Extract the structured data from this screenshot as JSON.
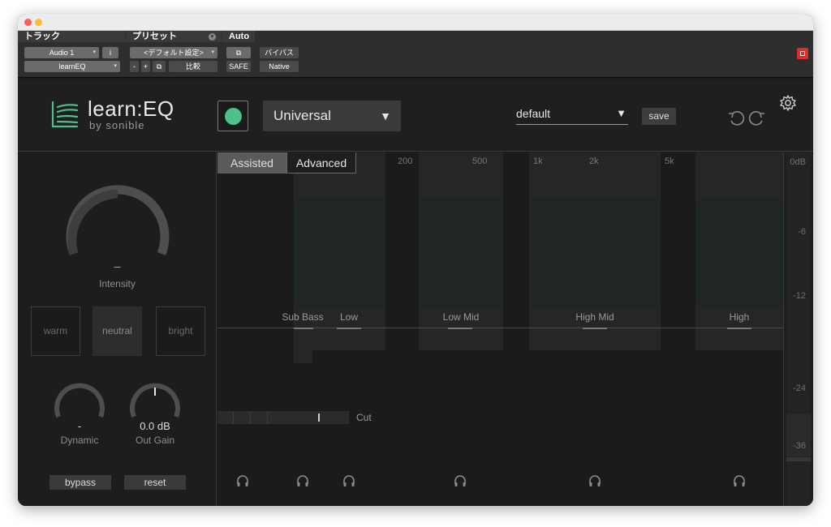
{
  "host": {
    "track_label": "トラック",
    "preset_label": "プリセット",
    "auto_label": "Auto",
    "track_name": "Audio 1",
    "track_index": "i",
    "plugin_name": "learnEQ",
    "preset_name": "<デフォルト設定>",
    "preset_minus": "-",
    "preset_plus": "+",
    "compare_label": "比較",
    "bypass_label": "バイパス",
    "safe_label": "SAFE",
    "native_label": "Native"
  },
  "plugin": {
    "logo_text": "learn:EQ",
    "logo_by": "by sonible",
    "profile_value": "Universal",
    "preset_value": "default",
    "save_label": "save",
    "intensity_value": "–",
    "intensity_label": "Intensity",
    "styles": [
      "warm",
      "neutral",
      "bright"
    ],
    "selected_style": "neutral",
    "dynamic_value": "-",
    "dynamic_label": "Dynamic",
    "outgain_value": "0.0 dB",
    "outgain_label": "Out Gain",
    "bypass_button": "bypass",
    "reset_button": "reset"
  },
  "eq": {
    "tabs": [
      "Assisted",
      "Advanced"
    ],
    "active_tab": "Advanced",
    "freq_labels": [
      "200",
      "500",
      "1k",
      "2k",
      "5k"
    ],
    "bands": [
      "Sub Bass",
      "Low",
      "Low Mid",
      "High Mid",
      "High"
    ],
    "cut_label": "Cut"
  },
  "meter": {
    "labels": [
      "0dB",
      "-6",
      "-12",
      "-24",
      "-36"
    ]
  },
  "colors": {
    "accent": "#4fbf8b",
    "host_bypass_red": "#d9302c"
  },
  "icons": [
    "undo-icon",
    "redo-icon",
    "gear-icon",
    "headphones-icon",
    "power-icon"
  ]
}
